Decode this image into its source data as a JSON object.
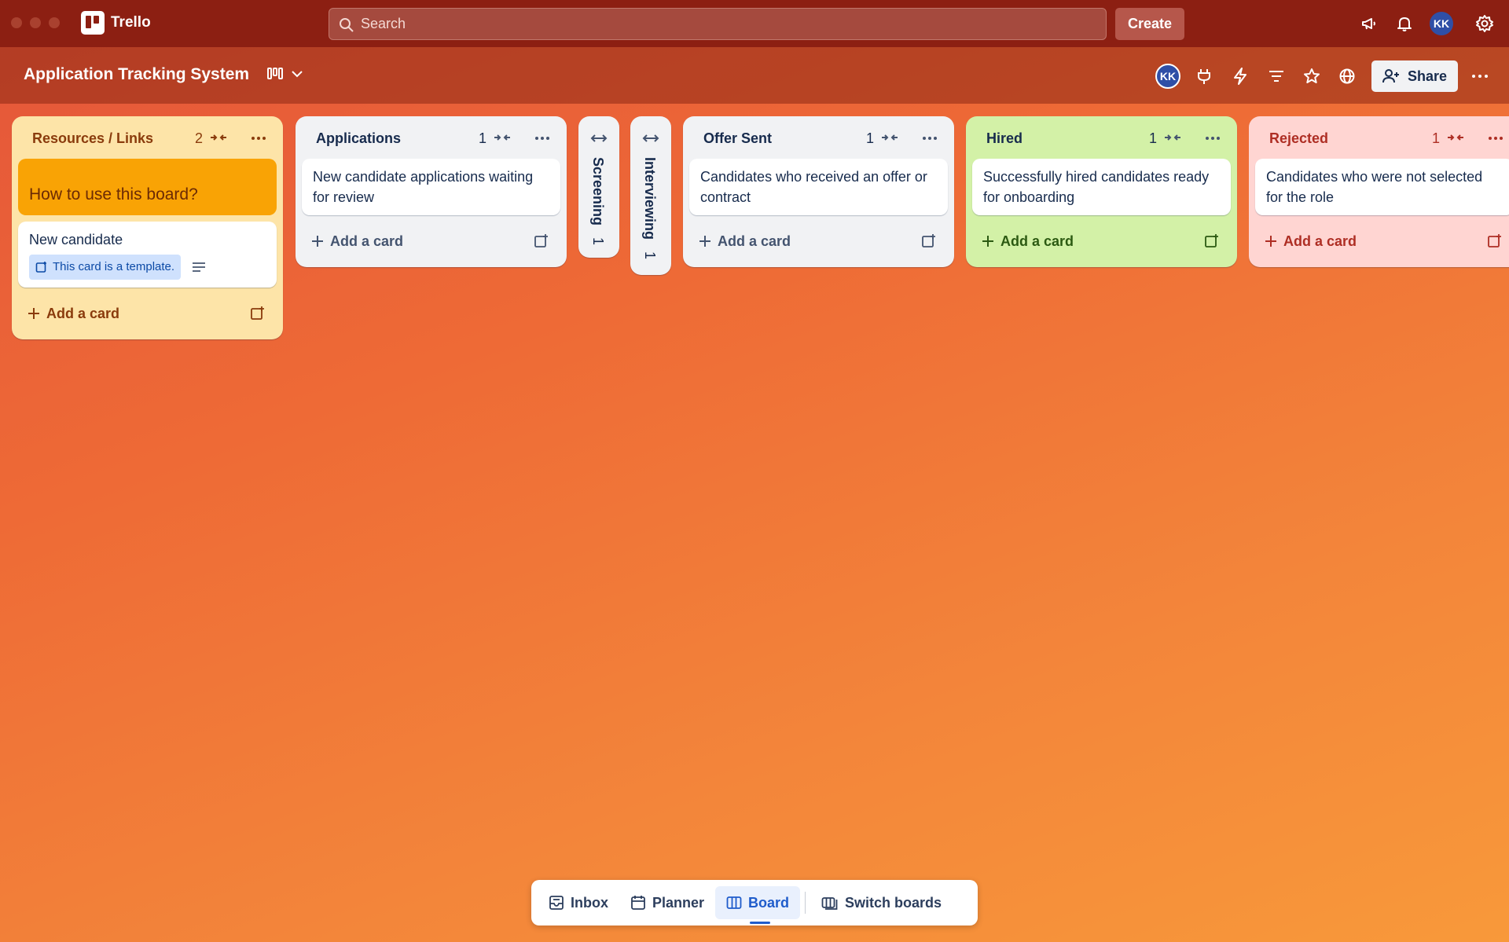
{
  "app": {
    "name": "Trello"
  },
  "topbar": {
    "search_placeholder": "Search",
    "create_label": "Create",
    "avatar_initials": "KK"
  },
  "board": {
    "title": "Application Tracking System",
    "member_initials": "KK",
    "share_label": "Share"
  },
  "lists": {
    "resources": {
      "title": "Resources / Links",
      "count": "2",
      "cover_card": "How to use this board?",
      "template_card": "New candidate",
      "template_badge": "This card is a template.",
      "add_label": "Add a card"
    },
    "applications": {
      "title": "Applications",
      "count": "1",
      "card": "New candidate applications waiting for review",
      "add_label": "Add a card"
    },
    "screening": {
      "title": "Screening",
      "count": "1"
    },
    "interviewing": {
      "title": "Interviewing",
      "count": "1"
    },
    "offer": {
      "title": "Offer Sent",
      "count": "1",
      "card": "Candidates who received an offer or contract",
      "add_label": "Add a card"
    },
    "hired": {
      "title": "Hired",
      "count": "1",
      "card": "Successfully hired candidates ready for onboarding",
      "add_label": "Add a card"
    },
    "rejected": {
      "title": "Rejected",
      "count": "1",
      "card": "Candidates who were not selected for the role",
      "add_label": "Add a card"
    }
  },
  "bottom_nav": {
    "inbox": "Inbox",
    "planner": "Planner",
    "board": "Board",
    "switch": "Switch boards"
  },
  "colors": {
    "topbar": "#8c1f12",
    "resources_list": "#fde4a8",
    "hired_list": "#d3f1a7",
    "rejected_list": "#ffd5d2",
    "accent": "#1f5ccb"
  }
}
